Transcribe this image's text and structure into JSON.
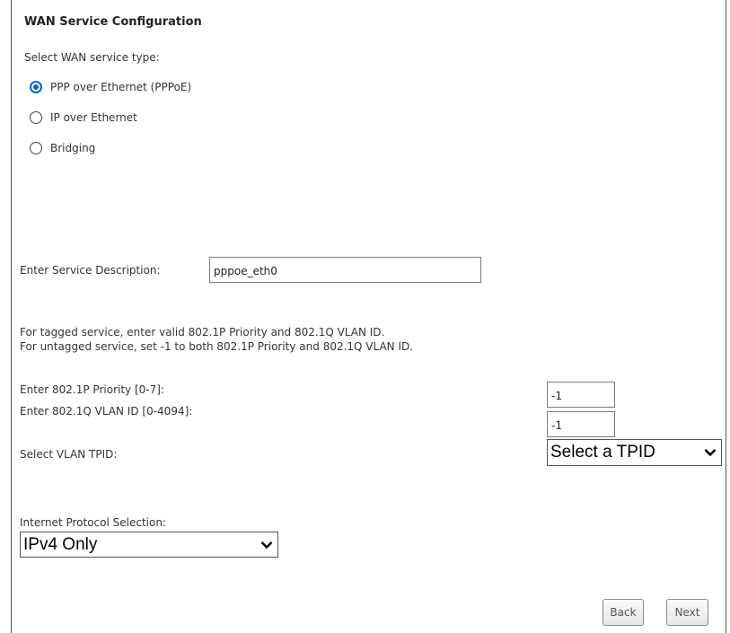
{
  "page_title": "WAN Service Configuration",
  "service_type": {
    "label": "Select WAN service type:",
    "options": [
      {
        "label": "PPP over Ethernet (PPPoE)",
        "checked": true
      },
      {
        "label": "IP over Ethernet",
        "checked": false
      },
      {
        "label": "Bridging",
        "checked": false
      }
    ]
  },
  "service_description": {
    "label": "Enter Service Description:",
    "value": "pppoe_eth0"
  },
  "vlan_help": {
    "tagged": "For tagged service, enter valid 802.1P Priority and 802.1Q VLAN ID.",
    "untagged": "For untagged service, set -1 to both 802.1P Priority and 802.1Q VLAN ID."
  },
  "priority": {
    "label": "Enter 802.1P Priority [0-7]:",
    "value": "-1"
  },
  "vlan_id": {
    "label": "Enter 802.1Q VLAN ID [0-4094]:",
    "value": "-1"
  },
  "tpid": {
    "label": "Select VLAN TPID:",
    "selected": "Select a TPID"
  },
  "protocol": {
    "label": "Internet Protocol Selection:",
    "selected": "IPv4 Only"
  },
  "buttons": {
    "back": "Back",
    "next": "Next"
  },
  "colors": {
    "radio_accent": "#0066cc",
    "border": "#555555"
  },
  "icons": {
    "dropdown": "chevron-down-icon"
  }
}
